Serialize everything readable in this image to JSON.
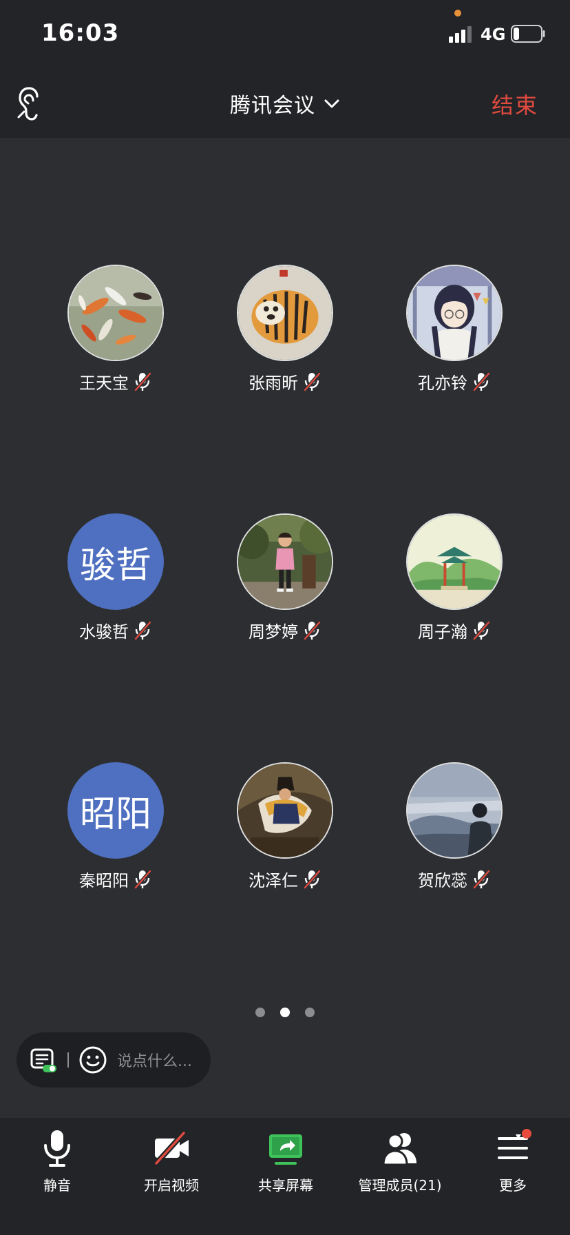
{
  "status_bar": {
    "time": "16:03",
    "network": "4G",
    "signal_bars": 3,
    "battery_level": 0.2
  },
  "header": {
    "title": "腾讯会议",
    "end_label": "结束",
    "end_color": "#e04a3f"
  },
  "participants": [
    {
      "name": "王天宝",
      "avatar": "photo-koi-fish",
      "muted": true
    },
    {
      "name": "张雨昕",
      "avatar": "photo-tiger-drawing",
      "muted": true
    },
    {
      "name": "孔亦铃",
      "avatar": "photo-anime-girl",
      "muted": true
    },
    {
      "name": "水骏哲",
      "avatar_text": "骏哲",
      "muted": true
    },
    {
      "name": "周梦婷",
      "avatar": "photo-girl-garden",
      "muted": true
    },
    {
      "name": "周子瀚",
      "avatar": "photo-pavilion-illustration",
      "muted": true
    },
    {
      "name": "秦昭阳",
      "avatar_text": "昭阳",
      "muted": true
    },
    {
      "name": "沈泽仁",
      "avatar": "photo-napoleon-painting",
      "muted": true
    },
    {
      "name": "贺欣蕊",
      "avatar": "photo-mountain-view",
      "muted": true
    }
  ],
  "pagination": {
    "total": 3,
    "current": 2
  },
  "chat": {
    "placeholder": "说点什么..."
  },
  "toolbar": {
    "mute_label": "静音",
    "video_label": "开启视频",
    "share_label": "共享屏幕",
    "manage_label": "管理成员(21)",
    "more_label": "更多",
    "share_color": "#3ec35a"
  },
  "colors": {
    "background": "#2c2e31",
    "bar": "#232427",
    "text_avatar": "#4f70c0",
    "notification": "#e84a3d"
  }
}
